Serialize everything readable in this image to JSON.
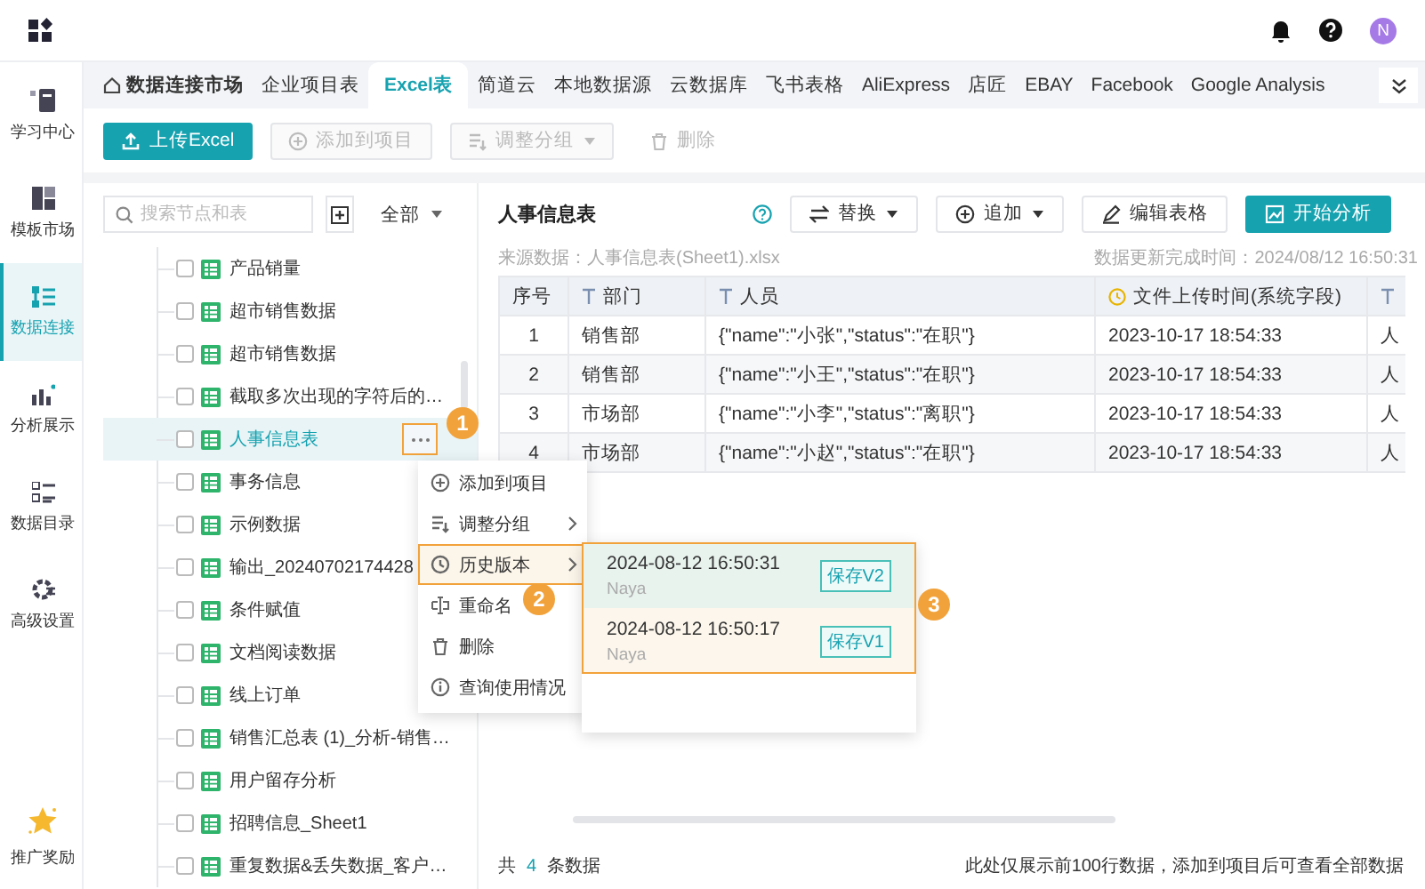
{
  "topbar": {
    "avatar": "N"
  },
  "rail": [
    {
      "label": "学习中心",
      "selected": false
    },
    {
      "label": "模板市场",
      "selected": false
    },
    {
      "label": "数据连接",
      "selected": true
    },
    {
      "label": "分析展示",
      "selected": false
    },
    {
      "label": "数据目录",
      "selected": false
    },
    {
      "label": "高级设置",
      "selected": false
    },
    {
      "label": "推广奖励",
      "selected": false
    }
  ],
  "tabs": [
    {
      "label": "数据连接市场",
      "kind": "home",
      "selected": false
    },
    {
      "label": "企业项目表",
      "kind": "plain",
      "selected": false
    },
    {
      "label": "Excel表",
      "kind": "plain",
      "selected": true
    },
    {
      "label": "简道云",
      "kind": "plain",
      "selected": false
    },
    {
      "label": "本地数据源",
      "kind": "plain",
      "selected": false
    },
    {
      "label": "云数据库",
      "kind": "plain",
      "selected": false
    },
    {
      "label": "飞书表格",
      "kind": "plain",
      "selected": false
    },
    {
      "label": "AliExpress",
      "kind": "plain",
      "selected": false
    },
    {
      "label": "店匠",
      "kind": "plain",
      "selected": false
    },
    {
      "label": "EBAY",
      "kind": "plain",
      "selected": false
    },
    {
      "label": "Facebook",
      "kind": "plain",
      "selected": false
    },
    {
      "label": "Google Analysis",
      "kind": "plain",
      "selected": false
    }
  ],
  "toolbar": [
    {
      "label": "上传Excel",
      "kind": "upload",
      "disabled": false
    },
    {
      "label": "添加到项目",
      "kind": "add",
      "disabled": true
    },
    {
      "label": "调整分组",
      "kind": "group",
      "disabled": true
    },
    {
      "label": "删除",
      "kind": "delete",
      "disabled": true
    }
  ],
  "tree": {
    "search_placeholder": "搜索节点和表",
    "filter": "全部",
    "items": [
      {
        "label": "产品销量",
        "checked": false,
        "selected": false,
        "menu_open": false
      },
      {
        "label": "超市销售数据",
        "checked": false,
        "selected": false,
        "menu_open": false
      },
      {
        "label": "超市销售数据",
        "checked": false,
        "selected": false,
        "menu_open": false
      },
      {
        "label": "截取多次出现的字符后的…",
        "checked": false,
        "selected": false,
        "menu_open": false
      },
      {
        "label": "人事信息表",
        "checked": false,
        "selected": true,
        "menu_open": true
      },
      {
        "label": "事务信息",
        "checked": false,
        "selected": false,
        "menu_open": false
      },
      {
        "label": "示例数据",
        "checked": false,
        "selected": false,
        "menu_open": false
      },
      {
        "label": "输出_20240702174428",
        "checked": false,
        "selected": false,
        "menu_open": false
      },
      {
        "label": "条件赋值",
        "checked": false,
        "selected": false,
        "menu_open": false
      },
      {
        "label": "文档阅读数据",
        "checked": false,
        "selected": false,
        "menu_open": false
      },
      {
        "label": "线上订单",
        "checked": false,
        "selected": false,
        "menu_open": false
      },
      {
        "label": "销售汇总表 (1)_分析-销售…",
        "checked": false,
        "selected": false,
        "menu_open": false
      },
      {
        "label": "用户留存分析",
        "checked": false,
        "selected": false,
        "menu_open": false
      },
      {
        "label": "招聘信息_Sheet1",
        "checked": false,
        "selected": false,
        "menu_open": false
      },
      {
        "label": "重复数据&丢失数据_客户…",
        "checked": false,
        "selected": false,
        "menu_open": false
      }
    ]
  },
  "table_panel": {
    "title": "人事信息表",
    "actions": [
      {
        "label": "替换",
        "kind": "swap"
      },
      {
        "label": "追加",
        "kind": "append"
      },
      {
        "label": "编辑表格",
        "kind": "edit"
      },
      {
        "label": "开始分析",
        "kind": "analyze"
      }
    ],
    "source": "来源数据：人事信息表(Sheet1).xlsx",
    "updated": "数据更新完成时间：2024/08/12 16:50:31",
    "columns": [
      {
        "label": "序号",
        "kind": "index"
      },
      {
        "label": "部门",
        "kind": "text"
      },
      {
        "label": "人员",
        "kind": "text"
      },
      {
        "label": "文件上传时间(系统字段)",
        "kind": "time"
      },
      {
        "kind": "text"
      }
    ],
    "rows": [
      [
        "1",
        "销售部",
        "{\"name\":\"小张\",\"status\":\"在职\"}",
        "2023-10-17 18:54:33",
        "人"
      ],
      [
        "2",
        "销售部",
        "{\"name\":\"小王\",\"status\":\"在职\"}",
        "2023-10-17 18:54:33",
        "人"
      ],
      [
        "3",
        "市场部",
        "{\"name\":\"小李\",\"status\":\"离职\"}",
        "2023-10-17 18:54:33",
        "人"
      ],
      [
        "4",
        "市场部",
        "{\"name\":\"小赵\",\"status\":\"在职\"}",
        "2023-10-17 18:54:33",
        "人"
      ]
    ],
    "footer": {
      "prefix": "共",
      "count": "4",
      "suffix": "条数据",
      "note": "此处仅展示前100行数据，添加到项目后可查看全部数据"
    }
  },
  "context_menu": {
    "items": [
      {
        "label": "添加到项目",
        "kind": "add",
        "submenu": false,
        "highlighted": false
      },
      {
        "label": "调整分组",
        "kind": "group",
        "submenu": true,
        "highlighted": false
      },
      {
        "label": "历史版本",
        "kind": "history",
        "submenu": true,
        "highlighted": true
      },
      {
        "label": "重命名",
        "kind": "rename",
        "submenu": false,
        "highlighted": false
      },
      {
        "label": "删除",
        "kind": "delete",
        "submenu": false,
        "highlighted": false
      },
      {
        "label": "查询使用情况",
        "kind": "info",
        "submenu": false,
        "highlighted": false
      }
    ]
  },
  "history": {
    "highlighted": true,
    "versions": [
      {
        "time": "2024-08-12 16:50:31",
        "user": "Naya",
        "tag": "保存V2",
        "selected": true
      },
      {
        "time": "2024-08-12 16:50:17",
        "user": "Naya",
        "tag": "保存V1",
        "selected": false
      }
    ]
  },
  "annotations": [
    "1",
    "2",
    "3"
  ]
}
